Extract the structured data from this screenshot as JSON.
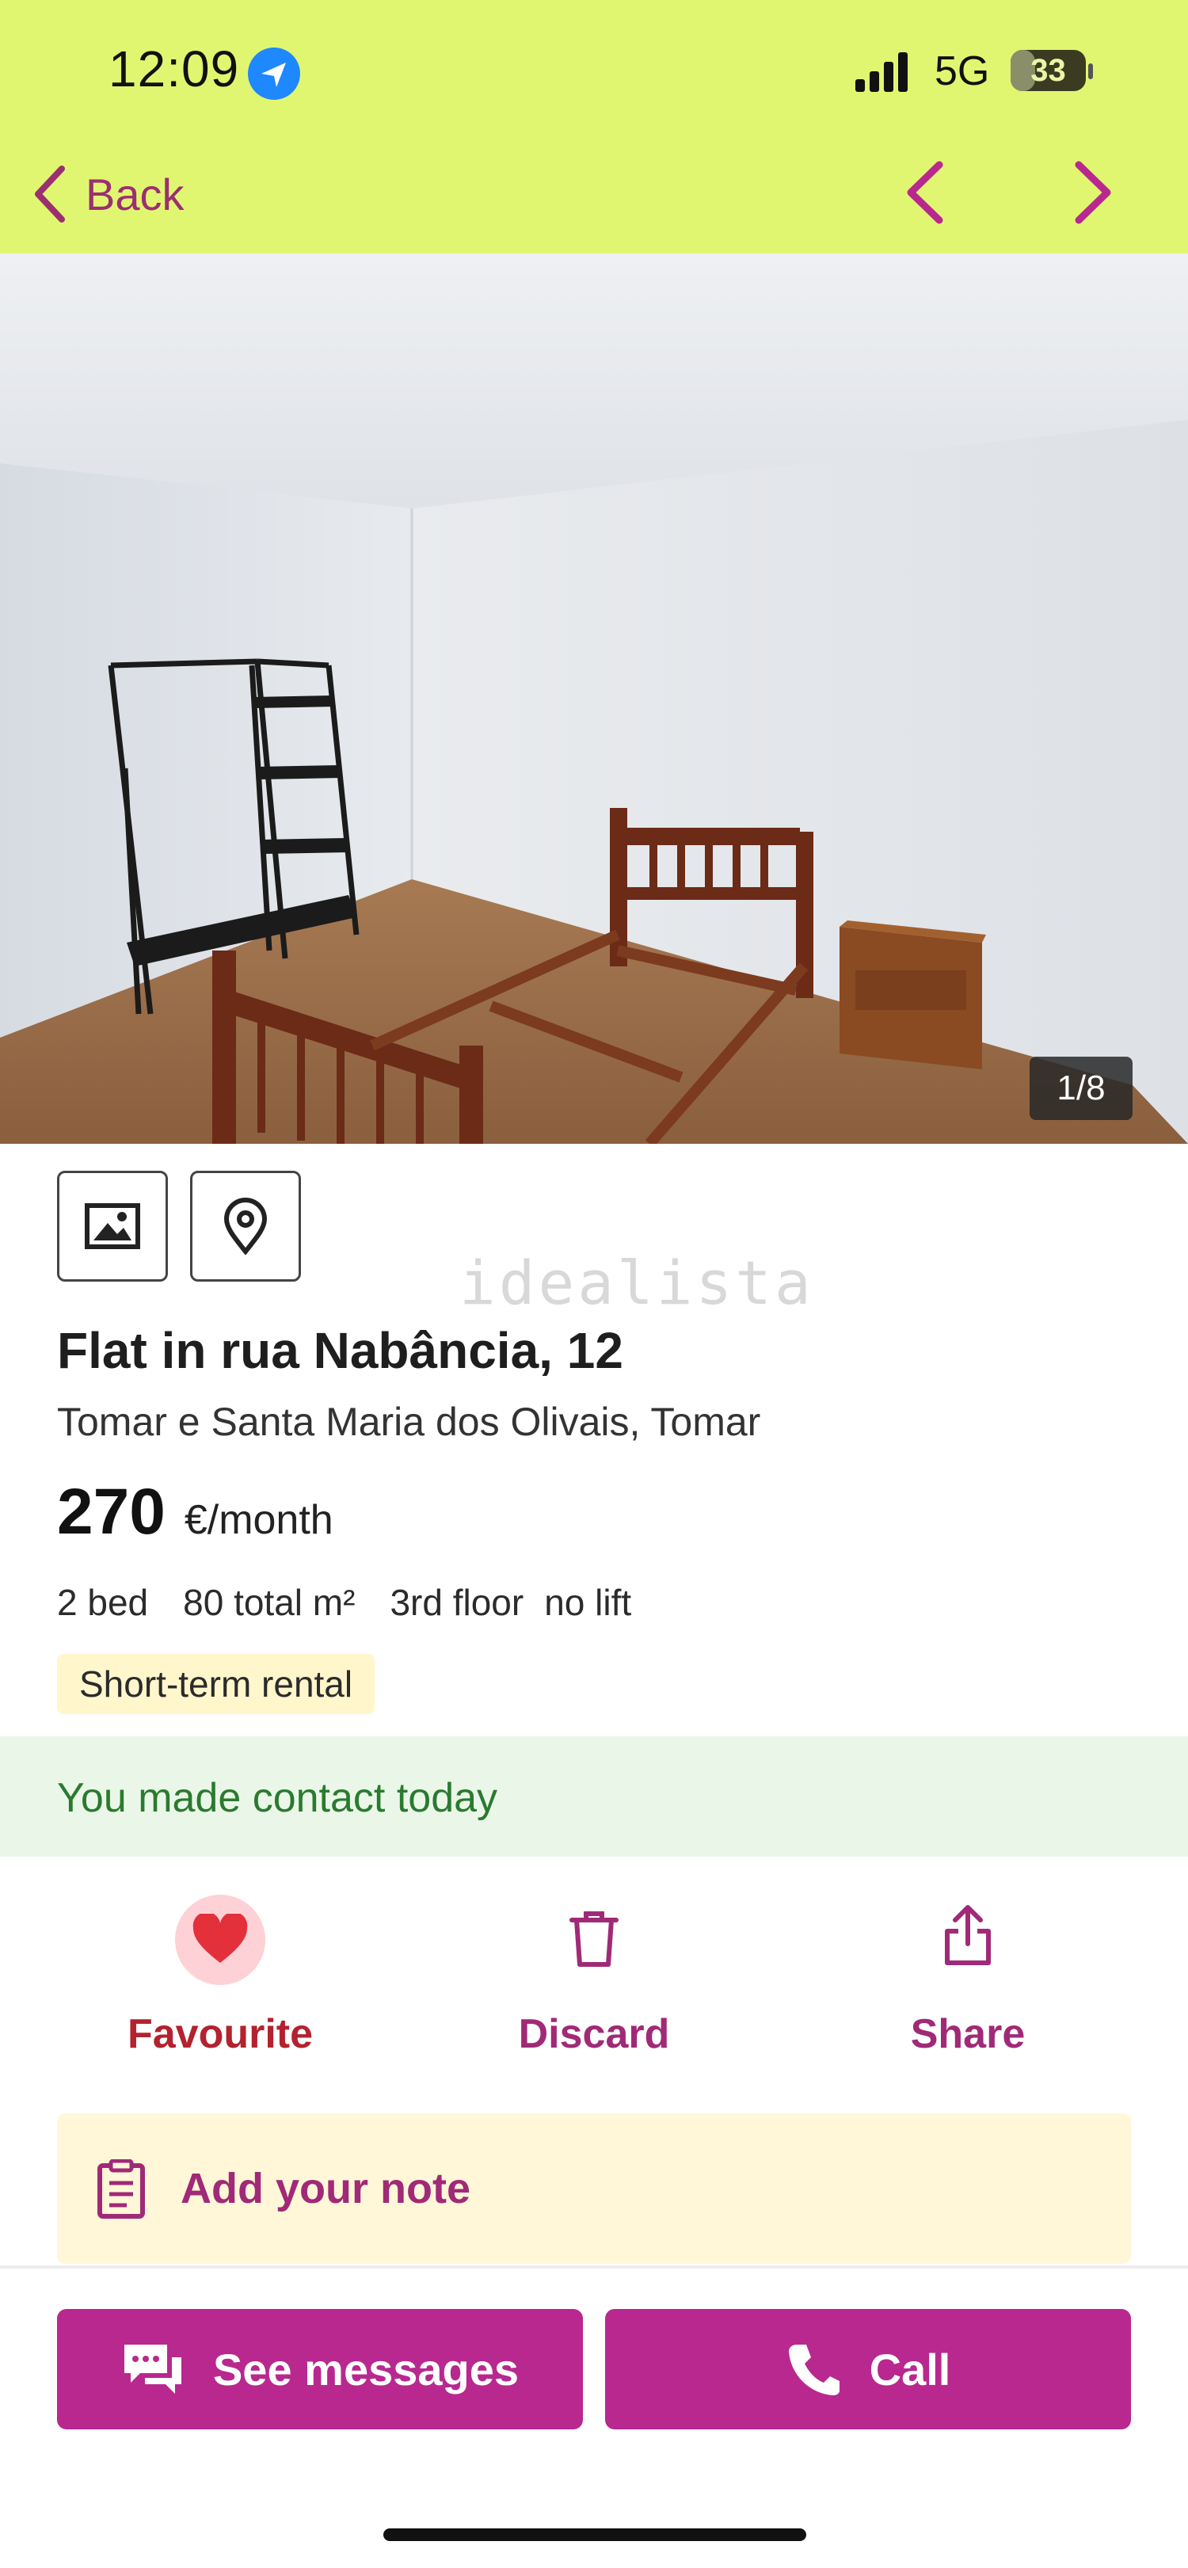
{
  "status_bar": {
    "time": "12:09",
    "network": "5G",
    "battery": "33",
    "battery_level": 0.33
  },
  "nav": {
    "back_label": "Back",
    "back_icon": "chevron-left-icon",
    "prev_icon": "chevron-left-icon",
    "next_icon": "chevron-right-icon"
  },
  "gallery": {
    "counter": "1/8"
  },
  "media_buttons": [
    {
      "icon": "photo-icon"
    },
    {
      "icon": "map-pin-icon"
    }
  ],
  "watermark": "idealista",
  "listing": {
    "title": "Flat in rua Nabância, 12",
    "location": "Tomar e Santa Maria dos Olivais, Tomar",
    "price": "270",
    "price_unit": "€/month",
    "features": [
      "2 bed",
      "80 total m²",
      "3rd floor",
      "no lift"
    ],
    "tag": "Short-term rental"
  },
  "contact_notice": "You made contact today",
  "actions": {
    "favourite": {
      "label": "Favourite",
      "icon": "heart-icon",
      "color": "#b3222f"
    },
    "discard": {
      "label": "Discard",
      "icon": "trash-icon",
      "color": "#a02a77"
    },
    "share": {
      "label": "Share",
      "icon": "share-icon",
      "color": "#a02a77"
    }
  },
  "note": {
    "label": "Add your note",
    "icon": "note-icon"
  },
  "bottom_buttons": {
    "messages": {
      "label": "See messages",
      "icon": "chat-icon"
    },
    "call": {
      "label": "Call",
      "icon": "phone-icon"
    }
  },
  "colors": {
    "header_bg": "#e1f670",
    "brand": "#b8288f",
    "contact_bg": "#eaf7e8",
    "contact_text": "#2a7a2f"
  }
}
